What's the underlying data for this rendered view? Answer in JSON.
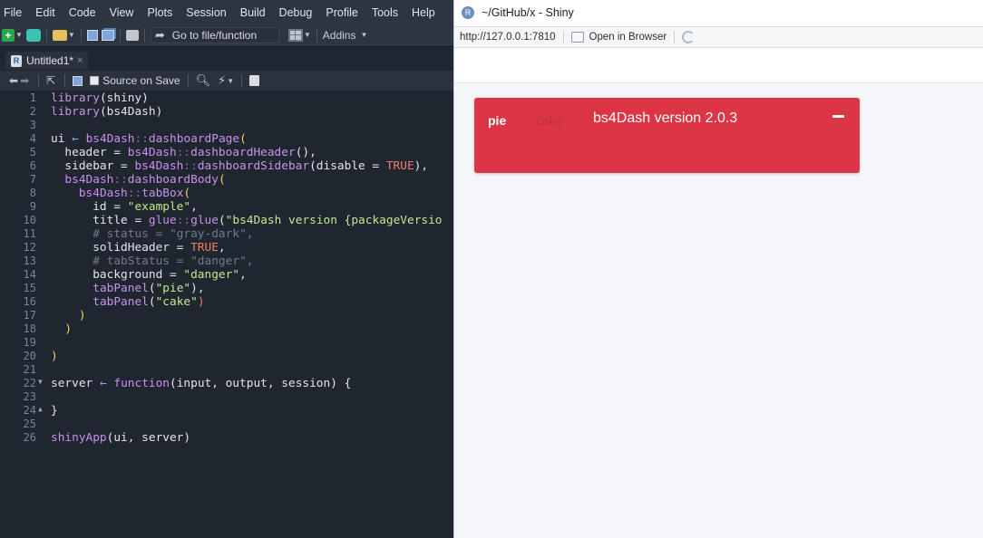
{
  "ide": {
    "menu": [
      "File",
      "Edit",
      "Code",
      "View",
      "Plots",
      "Session",
      "Build",
      "Debug",
      "Profile",
      "Tools",
      "Help"
    ],
    "toolbar": {
      "goto_label": "Go to file/function",
      "addins_label": "Addins"
    },
    "file_tab": {
      "name": "Untitled1*",
      "close": "×"
    },
    "editor_toolbar": {
      "source_on_save": "Source on Save"
    },
    "code_lines": [
      "1",
      "2",
      "3",
      "4",
      "5",
      "6",
      "7",
      "8",
      "9",
      "10",
      "11",
      "12",
      "13",
      "14",
      "15",
      "16",
      "17",
      "18",
      "19",
      "20",
      "21",
      "22",
      "23",
      "24",
      "25",
      "26"
    ]
  },
  "viewer": {
    "title": "~/GitHub/x - Shiny",
    "url": "http://127.0.0.1:7810",
    "open_in_browser": "Open in Browser",
    "tabbox": {
      "tab_active": "pie",
      "tab_inactive": "cake",
      "title": "bs4Dash version 2.0.3",
      "background_color": "#dc3545"
    }
  }
}
